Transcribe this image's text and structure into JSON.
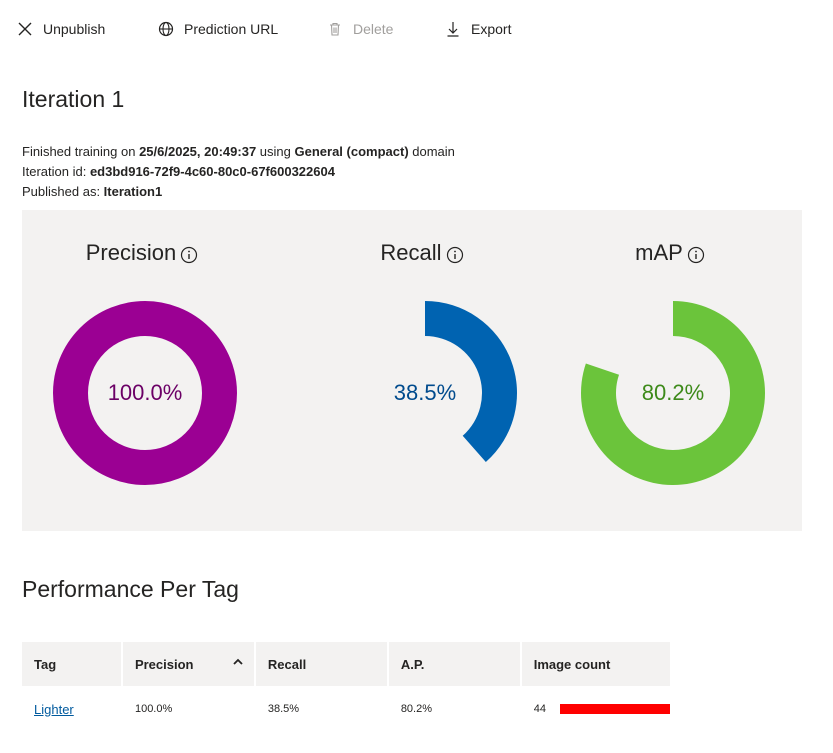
{
  "toolbar": {
    "unpublish_label": "Unpublish",
    "prediction_label": "Prediction URL",
    "delete_label": "Delete",
    "export_label": "Export"
  },
  "iteration": {
    "title": "Iteration 1",
    "finished_prefix": "Finished training on ",
    "finished_date": "25/6/2025, 20:49:37",
    "using_text": " using ",
    "domain_name": "General (compact)",
    "domain_suffix": " domain",
    "id_label": "Iteration id: ",
    "id_value": "ed3bd916-72f9-4c60-80c0-67f600322604",
    "published_label": "Published as: ",
    "published_value": "Iteration1"
  },
  "metrics": [
    {
      "name": "Precision",
      "value": 1.0,
      "value_label": "100.0%",
      "color": "#9b0093",
      "text_color": "#6b0066"
    },
    {
      "name": "Recall",
      "value": 0.385,
      "value_label": "38.5%",
      "color": "#0063b1",
      "text_color": "#004b8d"
    },
    {
      "name": "mAP",
      "value": 0.802,
      "value_label": "80.2%",
      "color": "#6bc43b",
      "text_color": "#3d8a1a"
    }
  ],
  "performance": {
    "title": "Performance Per Tag",
    "columns": [
      "Tag",
      "Precision",
      "Recall",
      "A.P.",
      "Image count"
    ],
    "rows": [
      {
        "tag": "Lighter",
        "precision": "100.0%",
        "recall": "38.5%",
        "ap": "80.2%",
        "image_count": "44",
        "count_fraction": 1.0
      }
    ],
    "bar_color": "#ff0000"
  }
}
